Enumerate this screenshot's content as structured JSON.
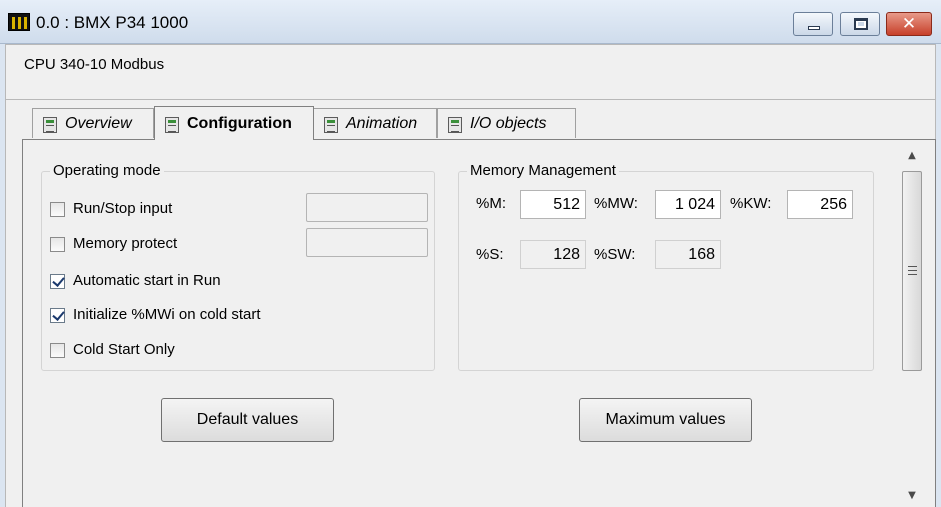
{
  "window": {
    "title": "0.0 : BMX P34 1000",
    "icon": "plc-rack-icon",
    "controls": [
      "minimize-icon",
      "maximize-icon",
      "close-icon"
    ],
    "close_glyph": "✕"
  },
  "header": {
    "description": "CPU 340-10 Modbus"
  },
  "tabs": [
    {
      "label": "Overview",
      "active": false
    },
    {
      "label": "Configuration",
      "active": true
    },
    {
      "label": "Animation",
      "active": false
    },
    {
      "label": "I/O objects",
      "active": false
    }
  ],
  "operating_mode": {
    "title": "Operating mode",
    "options": [
      {
        "label": "Run/Stop input",
        "checked": false
      },
      {
        "label": "Memory protect",
        "checked": false
      },
      {
        "label": "Automatic start in Run",
        "checked": true
      },
      {
        "label": "Initialize %MWi on cold start",
        "checked": true
      },
      {
        "label": "Cold Start Only",
        "checked": false
      }
    ]
  },
  "memory": {
    "title": "Memory Management",
    "m_label": "%M:",
    "m_value": "512",
    "mw_label": "%MW:",
    "mw_value": "1 024",
    "kw_label": "%KW:",
    "kw_value": "256",
    "s_label": "%S:",
    "s_value": "128",
    "sw_label": "%SW:",
    "sw_value": "168"
  },
  "buttons": {
    "default_label": "Default values",
    "maximum_label": "Maximum values"
  },
  "scrollbar": {
    "up_arrow": "▲",
    "down_arrow": "▼"
  },
  "colors": {
    "title_bar": "#cfdcec",
    "panel": "#f0f0f0",
    "close_button": "#c7402a"
  }
}
